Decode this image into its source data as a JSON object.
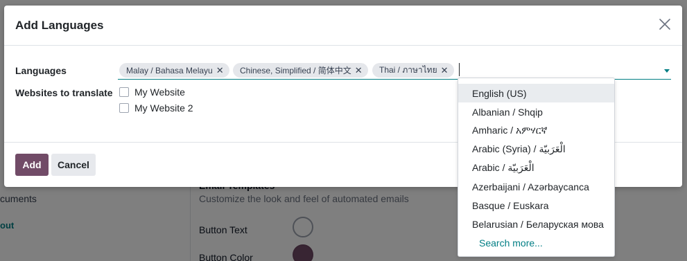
{
  "background": {
    "sidebar_text": "cuments",
    "sidebar_link": "out",
    "section_title": "Email Templates",
    "section_desc": "Customize the look and feel of automated emails",
    "button_text_label": "Button Text",
    "button_color_label": "Button Color"
  },
  "modal": {
    "title": "Add Languages",
    "languages_label": "Languages",
    "websites_label": "Websites to translate",
    "selected_tags": [
      "Malay / Bahasa Melayu",
      "Chinese, Simplified / 简体中文",
      "Thai / ภาษาไทย"
    ],
    "websites": [
      "My Website",
      "My Website 2"
    ],
    "add_label": "Add",
    "cancel_label": "Cancel"
  },
  "dropdown": {
    "options": [
      "English (US)",
      "Albanian / Shqip",
      "Amharic / አምሃርኛ",
      "Arabic (Syria) / الْعَرَبيّة",
      "Arabic / الْعَرَبيّة",
      "Azerbaijani / Azərbaycanca",
      "Basque / Euskara",
      "Belarusian / Беларуская мова"
    ],
    "search_more": "Search more..."
  },
  "colors": {
    "primary": "#714b67",
    "accent": "#017e84"
  },
  "icons": {
    "close": "close-icon",
    "remove_tag": "remove-tag-icon",
    "dropdown": "caret-down-icon"
  }
}
